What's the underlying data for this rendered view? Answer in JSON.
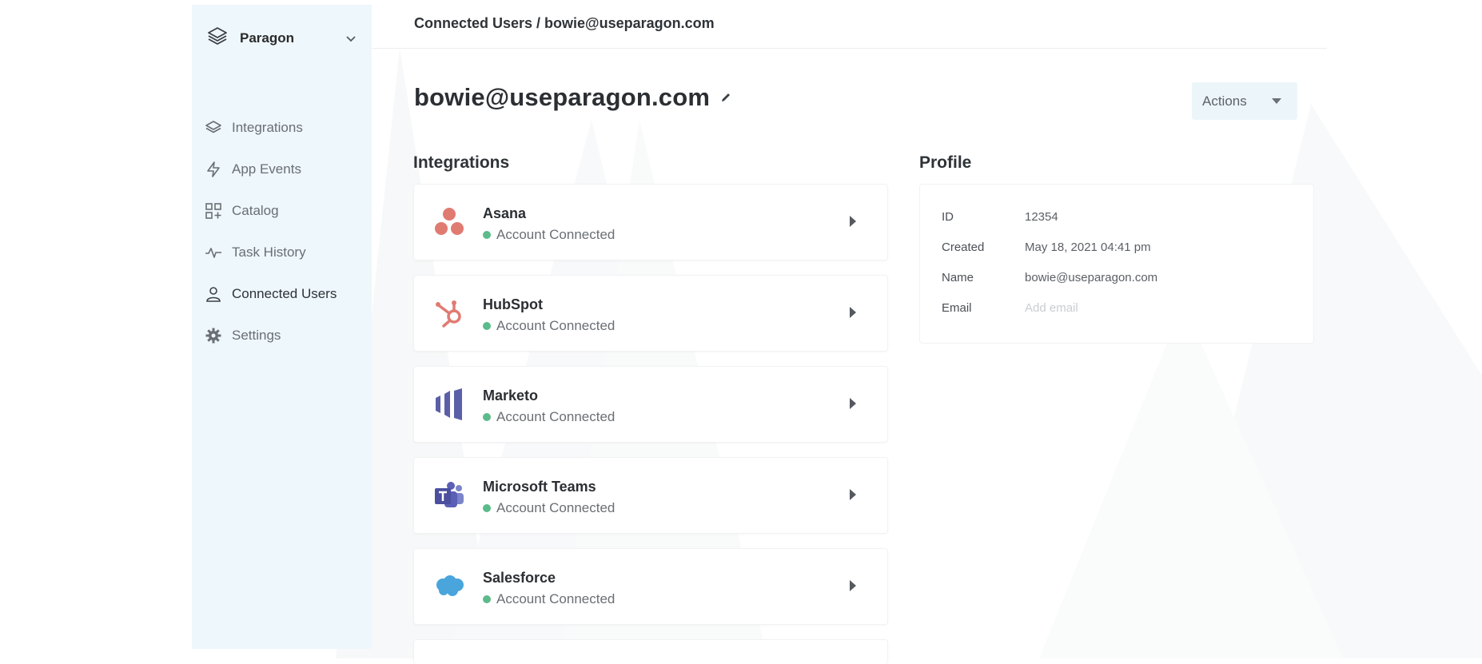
{
  "app": {
    "name": "Paragon"
  },
  "sidebar": {
    "items": [
      {
        "label": "Integrations",
        "icon": "layers-icon"
      },
      {
        "label": "App Events",
        "icon": "bolt-icon"
      },
      {
        "label": "Catalog",
        "icon": "catalog-icon"
      },
      {
        "label": "Task History",
        "icon": "pulse-icon"
      },
      {
        "label": "Connected Users",
        "icon": "user-icon",
        "active": true
      },
      {
        "label": "Settings",
        "icon": "gear-icon"
      }
    ]
  },
  "header": {
    "breadcrumb": "Connected Users / bowie@useparagon.com"
  },
  "page": {
    "title": "bowie@useparagon.com",
    "actions_label": "Actions",
    "integrations_heading": "Integrations",
    "profile_heading": "Profile"
  },
  "integrations": [
    {
      "name": "Asana",
      "status": "Account Connected",
      "icon": "asana-icon"
    },
    {
      "name": "HubSpot",
      "status": "Account Connected",
      "icon": "hubspot-icon"
    },
    {
      "name": "Marketo",
      "status": "Account Connected",
      "icon": "marketo-icon"
    },
    {
      "name": "Microsoft Teams",
      "status": "Account Connected",
      "icon": "microsoft-teams-icon"
    },
    {
      "name": "Salesforce",
      "status": "Account Connected",
      "icon": "salesforce-icon"
    }
  ],
  "profile": {
    "id_label": "ID",
    "id_value": "12354",
    "created_label": "Created",
    "created_value": "May 18, 2021 04:41 pm",
    "name_label": "Name",
    "name_value": "bowie@useparagon.com",
    "email_label": "Email",
    "email_placeholder": "Add email"
  },
  "colors": {
    "sidebar_bg": "#eef7fb",
    "status_green": "#5bbb8a",
    "actions_bg": "#ecf6fa"
  }
}
